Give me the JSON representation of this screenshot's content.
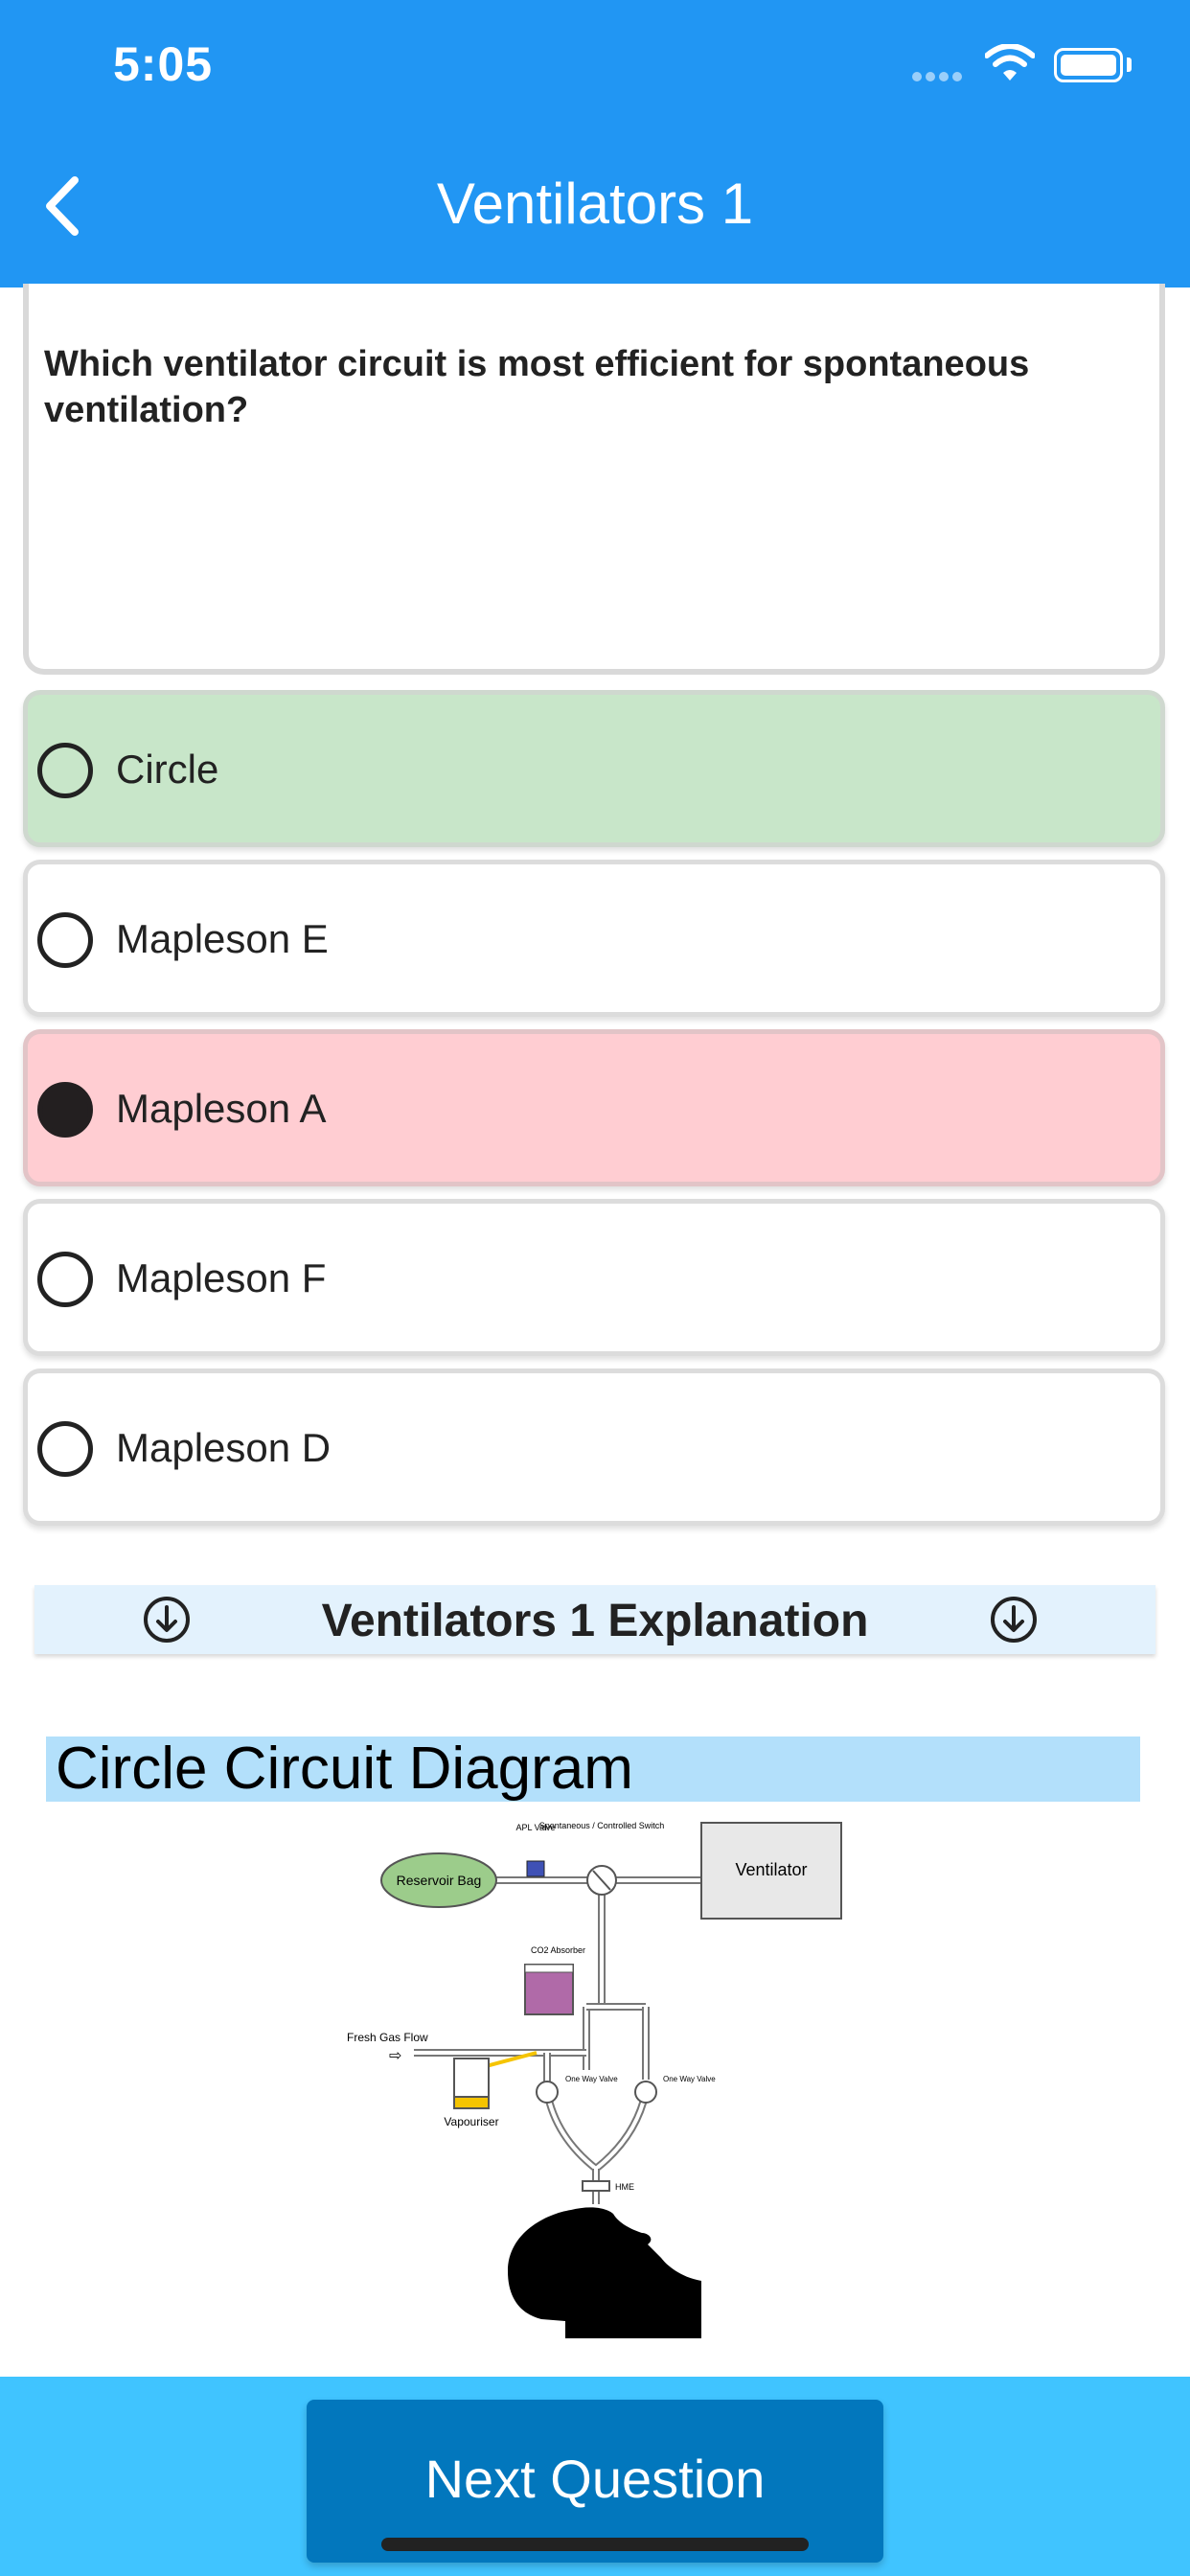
{
  "status": {
    "time": "5:05"
  },
  "nav": {
    "title": "Ventilators 1"
  },
  "question": {
    "text": "Which ventilator circuit is most efficient for spontaneous ventilation?"
  },
  "options": [
    {
      "label": "Circle",
      "state": "correct"
    },
    {
      "label": "Mapleson E",
      "state": "none"
    },
    {
      "label": "Mapleson A",
      "state": "selected-wrong"
    },
    {
      "label": "Mapleson F",
      "state": "none"
    },
    {
      "label": "Mapleson D",
      "state": "none"
    }
  ],
  "explanation": {
    "title": "Ventilators 1 Explanation"
  },
  "diagram": {
    "title": "Circle Circuit Diagram",
    "labels": {
      "reservoir": "Reservoir Bag",
      "apl": "APL Valve",
      "switch": "Spontaneous / Controlled Switch",
      "ventilator": "Ventilator",
      "co2": "CO2 Absorber",
      "fgf": "Fresh Gas Flow",
      "vapouriser": "Vapouriser",
      "valve1": "One Way Valve",
      "valve2": "One Way Valve",
      "hme": "HME"
    }
  },
  "footer": {
    "next_label": "Next Question"
  },
  "colors": {
    "nav": "#2196F3",
    "correct": "#c8e6c9",
    "wrong": "#ffcdd2",
    "footer": "#40C4FF",
    "button": "#0277BD"
  }
}
